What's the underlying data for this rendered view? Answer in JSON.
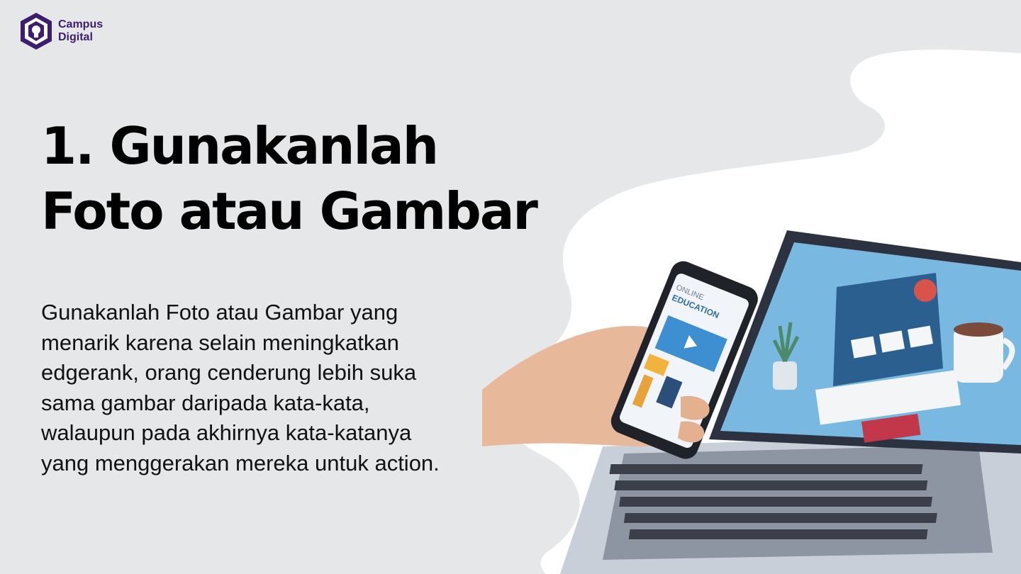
{
  "logo": {
    "line1": "Campus",
    "line2": "Digital",
    "icon": "campus-digital-logo-icon"
  },
  "title": {
    "line1": "1. Gunakanlah",
    "line2": "Foto atau Gambar"
  },
  "body": {
    "lines": [
      "Gunakanlah Foto atau Gambar yang",
      "menarik karena selain meningkatkan",
      "edgerank, orang cenderung lebih suka",
      "sama gambar daripada kata-kata,",
      "walaupun pada akhirnya kata-katanya",
      "yang menggerakan mereka untuk action."
    ]
  },
  "illustration": {
    "phone_text_1": "ONLINE",
    "phone_text_2": "EDUCATION",
    "icons": [
      "hand-holding-phone-icon",
      "laptop-icon",
      "plant-icon",
      "coffee-mug-icon"
    ]
  },
  "colors": {
    "background": "#e6e7e9",
    "blob": "#ffffff",
    "brand": "#3d1d6e",
    "text": "#111111"
  }
}
